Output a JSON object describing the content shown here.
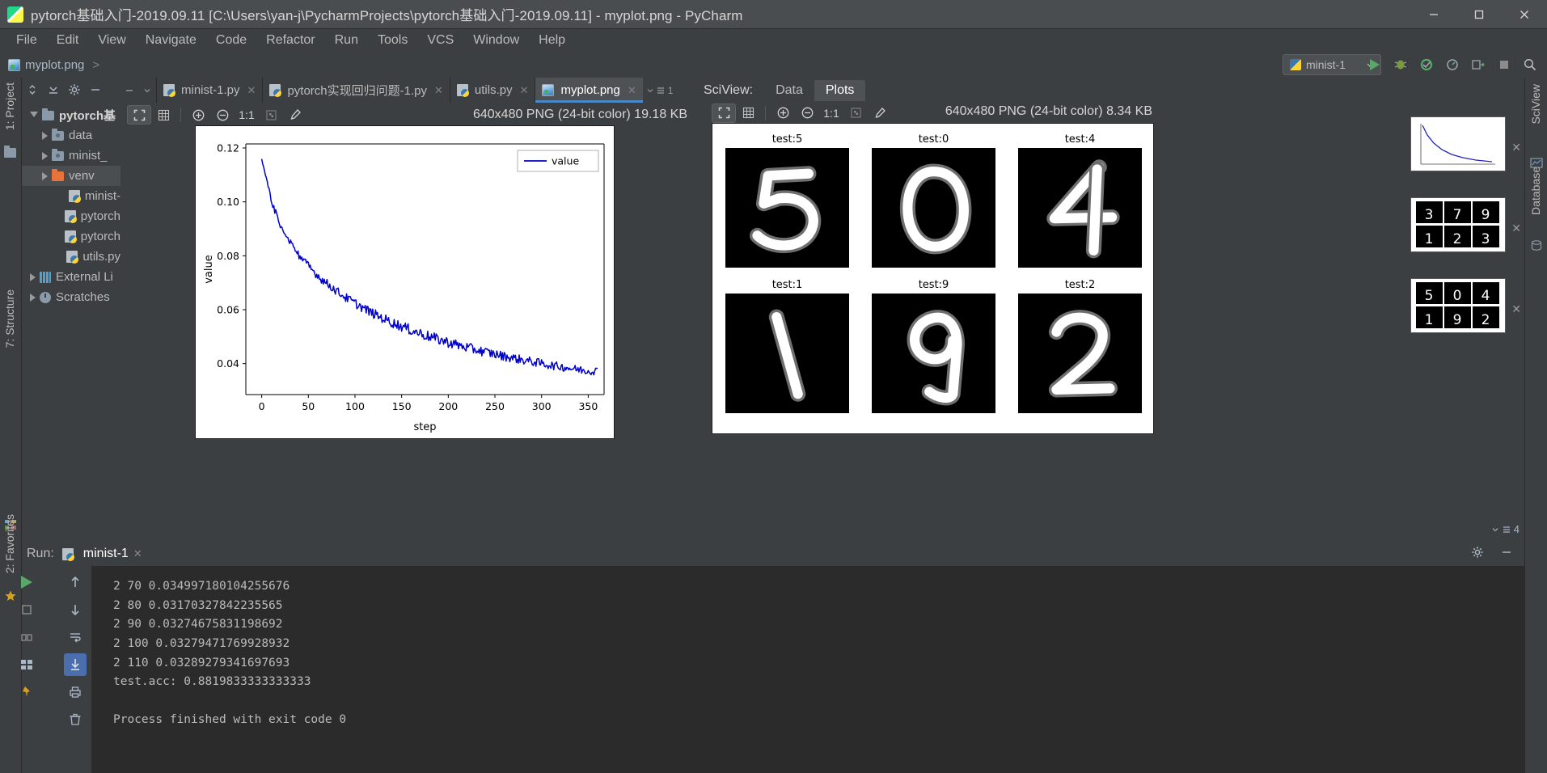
{
  "window": {
    "title": "pytorch基础入门-2019.09.11 [C:\\Users\\yan-j\\PycharmProjects\\pytorch基础入门-2019.09.11] - myplot.png - PyCharm",
    "app_icon": "pycharm-icon",
    "minimize": "minimize-icon",
    "maximize": "maximize-icon",
    "close": "close-icon"
  },
  "menu": {
    "items": [
      "File",
      "Edit",
      "View",
      "Navigate",
      "Code",
      "Refactor",
      "Run",
      "Tools",
      "VCS",
      "Window",
      "Help"
    ]
  },
  "breadcrumb": {
    "file": "myplot.png",
    "separator": ">"
  },
  "run_config": {
    "name": "minist-1",
    "chevron": "chevron-down-icon"
  },
  "toolbar_right": {
    "run": "run-icon",
    "debug": "debug-icon",
    "coverage": "coverage-icon",
    "profile": "profile-icon",
    "attach": "attach-icon",
    "stop": "stop-icon",
    "search": "search-icon"
  },
  "left_strip": {
    "project_tab": "1: Project",
    "structure_tab": "7: Structure",
    "favorites_tab": "2: Favorites"
  },
  "project": {
    "header_icons": [
      "collapse-all-icon",
      "expand-icon",
      "gear-icon",
      "hide-icon"
    ],
    "tree": [
      {
        "label": "pytorch基",
        "indent": 0,
        "arrow": "open",
        "icon": "folder",
        "bold": true
      },
      {
        "label": "data",
        "indent": 1,
        "arrow": "closed",
        "icon": "folder-dot",
        "bold": false
      },
      {
        "label": "minist_",
        "indent": 1,
        "arrow": "closed",
        "icon": "folder-dot",
        "bold": false
      },
      {
        "label": "venv",
        "indent": 1,
        "arrow": "closed",
        "icon": "folder-orange",
        "bold": false,
        "selected": true
      },
      {
        "label": "minist-",
        "indent": 2,
        "arrow": "none",
        "icon": "python-file",
        "bold": false
      },
      {
        "label": "pytorch",
        "indent": 2,
        "arrow": "none",
        "icon": "python-file",
        "bold": false
      },
      {
        "label": "pytorch",
        "indent": 2,
        "arrow": "none",
        "icon": "python-file",
        "bold": false
      },
      {
        "label": "utils.py",
        "indent": 2,
        "arrow": "none",
        "icon": "python-file",
        "bold": false
      },
      {
        "label": "External Li",
        "indent": 0,
        "arrow": "closed",
        "icon": "library",
        "bold": false
      },
      {
        "label": "Scratches ",
        "indent": 0,
        "arrow": "closed",
        "icon": "scratch",
        "bold": false
      }
    ]
  },
  "editor": {
    "tabs": [
      {
        "label": "minist-1.py",
        "icon": "python-file-icon",
        "active": false
      },
      {
        "label": "pytorch实现回归问题-1.py",
        "icon": "python-file-icon",
        "active": false
      },
      {
        "label": "utils.py",
        "icon": "python-file-icon",
        "active": false
      },
      {
        "label": "myplot.png",
        "icon": "image-file-icon",
        "active": true
      }
    ],
    "tab_overflow": "1",
    "image_toolbar": {
      "fit": "fit-to-window-icon",
      "grid": "toggle-grid-icon",
      "zoom_in": "zoom-in-icon",
      "zoom_out": "zoom-out-icon",
      "actual_size": "1:1",
      "transparency": "transparency-chessboard-icon",
      "color_picker": "color-picker-icon"
    },
    "image_info": "640x480 PNG (24-bit color) 19.18 KB"
  },
  "sciview": {
    "title": "SciView:",
    "tabs": [
      {
        "label": "Data",
        "active": false
      },
      {
        "label": "Plots",
        "active": true
      }
    ],
    "header_icons": [
      "gear-icon",
      "hide-icon"
    ],
    "image_toolbar": {
      "fit": "fit-to-window-icon",
      "grid": "toggle-grid-icon",
      "zoom_in": "zoom-in-icon",
      "zoom_out": "zoom-out-icon",
      "actual_size": "1:1",
      "transparency": "transparency-chessboard-icon",
      "color_picker": "color-picker-icon"
    },
    "image_info": "640x480 PNG (24-bit color) 8.34 KB",
    "digits": [
      {
        "label": "test:5",
        "digit": "5"
      },
      {
        "label": "test:0",
        "digit": "0"
      },
      {
        "label": "test:4",
        "digit": "4"
      },
      {
        "label": "test:1",
        "digit": "1"
      },
      {
        "label": "test:9",
        "digit": "9"
      },
      {
        "label": "test:2",
        "digit": "2"
      }
    ]
  },
  "thumbnails": {
    "items": [
      {
        "name": "loss-curve-thumbnail",
        "close": "close-icon"
      },
      {
        "name": "digits-grid-thumbnail-1",
        "close": "close-icon"
      },
      {
        "name": "digits-grid-thumbnail-2",
        "close": "close-icon"
      }
    ],
    "count": "4",
    "count_icon": "list-icon"
  },
  "right_strip": {
    "sciview_tab": "SciView",
    "database_tab": "Database"
  },
  "run_panel": {
    "label": "Run:",
    "tab": "minist-1",
    "tab_icon": "python-run-icon",
    "close": "close-icon",
    "header_icons": [
      "gear-icon",
      "hide-icon"
    ],
    "side_icons": [
      "rerun-icon",
      "up-arrow-icon",
      "down-arrow-icon",
      "pause-icon",
      "soft-wrap-icon",
      "scroll-to-end-icon",
      "print-icon",
      "clear-all-icon"
    ],
    "console_lines": [
      "2 70 0.034997180104255676",
      "2 80 0.03170327842235565",
      "2 90 0.03274675831198692",
      "2 100 0.03279471769928932",
      "2 110 0.03289279341697693",
      "test.acc: 0.8819833333333333",
      "",
      "Process finished with exit code 0"
    ]
  },
  "colors": {
    "accent": "#4a88c7",
    "panel_bg": "#3c3f41",
    "console_bg": "#2b2b2b",
    "plot_line": "#0000cd",
    "text": "#bbbbbb",
    "selection": "#4b4e50"
  },
  "chart_data": {
    "type": "line",
    "title": "",
    "xlabel": "step",
    "ylabel": "value",
    "legend": [
      "value"
    ],
    "legend_position": "upper right",
    "xlim": [
      -17,
      367
    ],
    "ylim": [
      0.0285,
      0.1215
    ],
    "xticks": [
      0,
      50,
      100,
      150,
      200,
      250,
      300,
      350
    ],
    "yticks": [
      0.04,
      0.06,
      0.08,
      0.1,
      0.12
    ],
    "grid": false,
    "series": [
      {
        "name": "value",
        "x": [
          0,
          5,
          10,
          15,
          20,
          25,
          30,
          35,
          40,
          45,
          50,
          55,
          60,
          65,
          70,
          75,
          80,
          85,
          90,
          95,
          100,
          105,
          110,
          115,
          120,
          125,
          130,
          135,
          140,
          145,
          150,
          155,
          160,
          165,
          170,
          175,
          180,
          185,
          190,
          195,
          200,
          205,
          210,
          215,
          220,
          225,
          230,
          235,
          240,
          245,
          250,
          255,
          260,
          265,
          270,
          275,
          280,
          285,
          290,
          295,
          300,
          305,
          310,
          315,
          320,
          325,
          330,
          335,
          340,
          345,
          350
        ],
        "y": [
          0.1155,
          0.1085,
          0.1012,
          0.096,
          0.0916,
          0.088,
          0.0852,
          0.0824,
          0.08,
          0.0782,
          0.0762,
          0.0744,
          0.0727,
          0.0711,
          0.0697,
          0.0684,
          0.067,
          0.0658,
          0.0645,
          0.0635,
          0.0624,
          0.0614,
          0.0604,
          0.0594,
          0.0585,
          0.0576,
          0.0568,
          0.056,
          0.0552,
          0.0545,
          0.0538,
          0.0531,
          0.0524,
          0.0518,
          0.0512,
          0.0506,
          0.05,
          0.0494,
          0.0489,
          0.0484,
          0.0479,
          0.0474,
          0.0469,
          0.0464,
          0.046,
          0.0455,
          0.0451,
          0.0447,
          0.0443,
          0.0439,
          0.0435,
          0.0431,
          0.0427,
          0.0424,
          0.042,
          0.0417,
          0.0413,
          0.041,
          0.0407,
          0.0404,
          0.04,
          0.0397,
          0.0394,
          0.0391,
          0.0389,
          0.0386,
          0.0383,
          0.038,
          0.0378,
          0.0375,
          0.0373
        ]
      }
    ]
  }
}
